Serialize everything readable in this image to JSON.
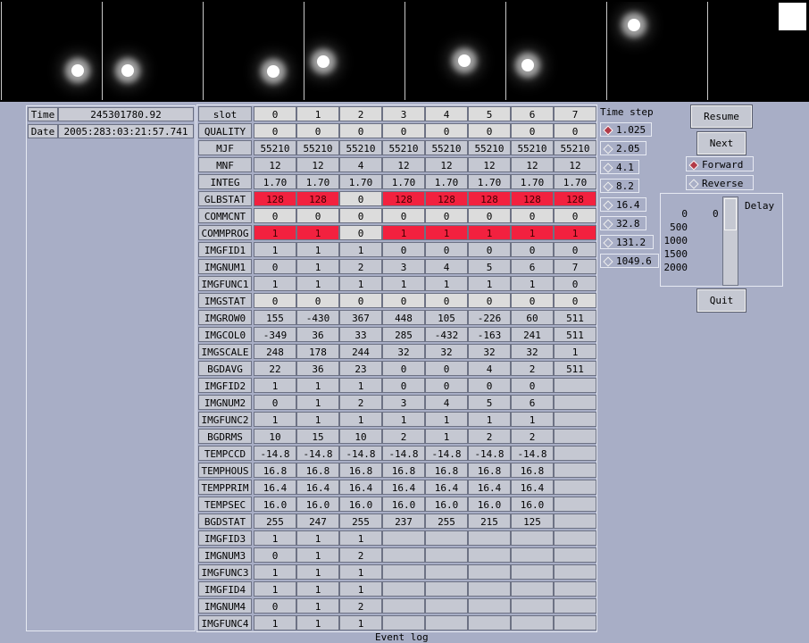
{
  "left": {
    "time_label": "Time",
    "time_value": "245301780.92",
    "date_label": "Date",
    "date_value": "2005:283:03:21:57.741"
  },
  "grid": {
    "slots": [
      "0",
      "1",
      "2",
      "3",
      "4",
      "5",
      "6",
      "7"
    ],
    "rows": [
      {
        "name": "slot",
        "values": [
          "0",
          "1",
          "2",
          "3",
          "4",
          "5",
          "6",
          "7"
        ]
      },
      {
        "name": "QUALITY",
        "values": [
          "0",
          "0",
          "0",
          "0",
          "0",
          "0",
          "0",
          "0"
        ],
        "style": "light"
      },
      {
        "name": "MJF",
        "values": [
          "55210",
          "55210",
          "55210",
          "55210",
          "55210",
          "55210",
          "55210",
          "55210"
        ]
      },
      {
        "name": "MNF",
        "values": [
          "12",
          "12",
          "4",
          "12",
          "12",
          "12",
          "12",
          "12"
        ]
      },
      {
        "name": "INTEG",
        "values": [
          "1.70",
          "1.70",
          "1.70",
          "1.70",
          "1.70",
          "1.70",
          "1.70",
          "1.70"
        ]
      },
      {
        "name": "GLBSTAT",
        "values": [
          "128",
          "128",
          "0",
          "128",
          "128",
          "128",
          "128",
          "128"
        ],
        "red": [
          0,
          1,
          3,
          4,
          5,
          6,
          7
        ]
      },
      {
        "name": "COMMCNT",
        "values": [
          "0",
          "0",
          "0",
          "0",
          "0",
          "0",
          "0",
          "0"
        ],
        "style": "light"
      },
      {
        "name": "COMMPROG",
        "values": [
          "1",
          "1",
          "0",
          "1",
          "1",
          "1",
          "1",
          "1"
        ],
        "red": [
          0,
          1,
          3,
          4,
          5,
          6,
          7
        ]
      },
      {
        "name": "IMGFID1",
        "values": [
          "1",
          "1",
          "1",
          "0",
          "0",
          "0",
          "0",
          "0"
        ]
      },
      {
        "name": "IMGNUM1",
        "values": [
          "0",
          "1",
          "2",
          "3",
          "4",
          "5",
          "6",
          "7"
        ]
      },
      {
        "name": "IMGFUNC1",
        "values": [
          "1",
          "1",
          "1",
          "1",
          "1",
          "1",
          "1",
          "0"
        ]
      },
      {
        "name": "IMGSTAT",
        "values": [
          "0",
          "0",
          "0",
          "0",
          "0",
          "0",
          "0",
          "0"
        ],
        "style": "light"
      },
      {
        "name": "IMGROW0",
        "values": [
          "155",
          "-430",
          "367",
          "448",
          "105",
          "-226",
          "60",
          "511"
        ]
      },
      {
        "name": "IMGCOL0",
        "values": [
          "-349",
          "36",
          "33",
          "285",
          "-432",
          "-163",
          "241",
          "511"
        ]
      },
      {
        "name": "IMGSCALE",
        "values": [
          "248",
          "178",
          "244",
          "32",
          "32",
          "32",
          "32",
          "1"
        ]
      },
      {
        "name": "BGDAVG",
        "values": [
          "22",
          "36",
          "23",
          "0",
          "0",
          "4",
          "2",
          "511"
        ]
      },
      {
        "name": "IMGFID2",
        "values": [
          "1",
          "1",
          "1",
          "0",
          "0",
          "0",
          "0",
          ""
        ]
      },
      {
        "name": "IMGNUM2",
        "values": [
          "0",
          "1",
          "2",
          "3",
          "4",
          "5",
          "6",
          ""
        ]
      },
      {
        "name": "IMGFUNC2",
        "values": [
          "1",
          "1",
          "1",
          "1",
          "1",
          "1",
          "1",
          ""
        ]
      },
      {
        "name": "BGDRMS",
        "values": [
          "10",
          "15",
          "10",
          "2",
          "1",
          "2",
          "2",
          ""
        ]
      },
      {
        "name": "TEMPCCD",
        "values": [
          "-14.8",
          "-14.8",
          "-14.8",
          "-14.8",
          "-14.8",
          "-14.8",
          "-14.8",
          ""
        ]
      },
      {
        "name": "TEMPHOUS",
        "values": [
          "16.8",
          "16.8",
          "16.8",
          "16.8",
          "16.8",
          "16.8",
          "16.8",
          ""
        ]
      },
      {
        "name": "TEMPPRIM",
        "values": [
          "16.4",
          "16.4",
          "16.4",
          "16.4",
          "16.4",
          "16.4",
          "16.4",
          ""
        ]
      },
      {
        "name": "TEMPSEC",
        "values": [
          "16.0",
          "16.0",
          "16.0",
          "16.0",
          "16.0",
          "16.0",
          "16.0",
          ""
        ]
      },
      {
        "name": "BGDSTAT",
        "values": [
          "255",
          "247",
          "255",
          "237",
          "255",
          "215",
          "125",
          ""
        ]
      },
      {
        "name": "IMGFID3",
        "values": [
          "1",
          "1",
          "1",
          "",
          "",
          "",
          "",
          ""
        ]
      },
      {
        "name": "IMGNUM3",
        "values": [
          "0",
          "1",
          "2",
          "",
          "",
          "",
          "",
          ""
        ]
      },
      {
        "name": "IMGFUNC3",
        "values": [
          "1",
          "1",
          "1",
          "",
          "",
          "",
          "",
          ""
        ]
      },
      {
        "name": "IMGFID4",
        "values": [
          "1",
          "1",
          "1",
          "",
          "",
          "",
          "",
          ""
        ]
      },
      {
        "name": "IMGNUM4",
        "values": [
          "0",
          "1",
          "2",
          "",
          "",
          "",
          "",
          ""
        ]
      },
      {
        "name": "IMGFUNC4",
        "values": [
          "1",
          "1",
          "1",
          "",
          "",
          "",
          "",
          ""
        ]
      }
    ]
  },
  "timestep": {
    "label": "Time step",
    "options": [
      "1.025",
      "2.05",
      "4.1",
      "8.2",
      "16.4",
      "32.8",
      "131.2",
      "1049.6"
    ],
    "selected": 0
  },
  "controls": {
    "resume": "Resume",
    "next": "Next",
    "forward": "Forward",
    "reverse": "Reverse",
    "direction_selected": "forward",
    "quit": "Quit"
  },
  "delay": {
    "label": "Delay",
    "value": "0",
    "scale": [
      "0",
      "500",
      "1000",
      "1500",
      "2000"
    ]
  },
  "event_log_label": "Event log",
  "colors": {
    "alarm": "#f2213f",
    "background": "#a8aec6"
  }
}
